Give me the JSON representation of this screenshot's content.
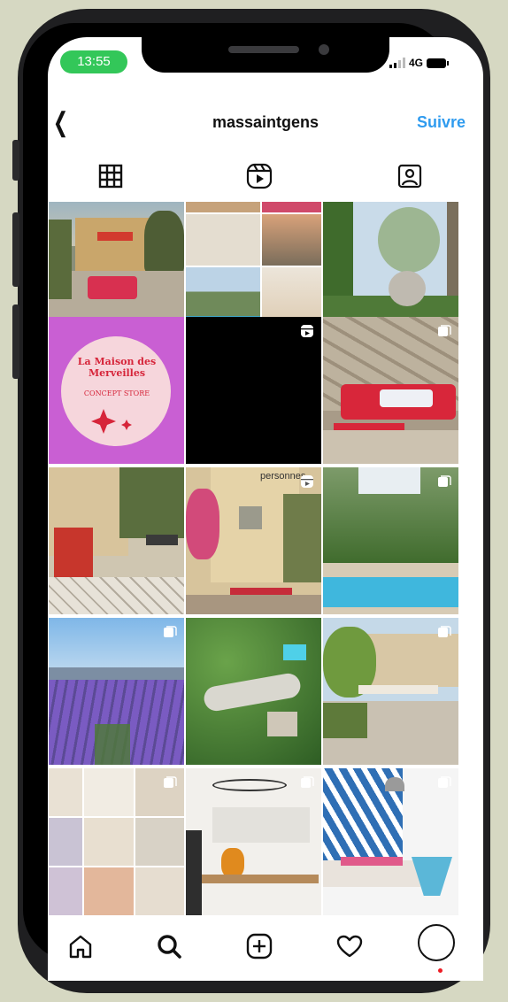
{
  "status_bar": {
    "time": "13:55",
    "network": "4G"
  },
  "header": {
    "back_icon": "chevron-left-icon",
    "username": "massaintgens",
    "follow_label": "Suivre"
  },
  "tabs": [
    {
      "name": "tab-posts",
      "icon": "grid-icon",
      "active": true
    },
    {
      "name": "tab-reels",
      "icon": "reels-icon",
      "active": false
    },
    {
      "name": "tab-tagged",
      "icon": "tagged-person-icon",
      "active": false
    }
  ],
  "posts": [
    {
      "name": "post-1",
      "subject": "terrace-facade",
      "badge": null
    },
    {
      "name": "post-2",
      "subject": "photo-collage",
      "badge": null
    },
    {
      "name": "post-3",
      "subject": "garden-tree",
      "badge": null
    },
    {
      "name": "post-4",
      "subject": "logo",
      "badge": null,
      "logo_text": "La Maison des Merveilles",
      "logo_sub": "CONCEPT STORE"
    },
    {
      "name": "post-5",
      "subject": "black-video",
      "badge": "reels-icon"
    },
    {
      "name": "post-6",
      "subject": "stone-wall-bench",
      "badge": "carousel-icon"
    },
    {
      "name": "post-7",
      "subject": "courtyard",
      "badge": null
    },
    {
      "name": "post-8",
      "subject": "house-flowers",
      "badge": "reels-icon",
      "overlay_text": "personnes"
    },
    {
      "name": "post-9",
      "subject": "pool",
      "badge": "carousel-icon"
    },
    {
      "name": "post-10",
      "subject": "lavender",
      "badge": "carousel-icon"
    },
    {
      "name": "post-11",
      "subject": "aerial",
      "badge": null
    },
    {
      "name": "post-12",
      "subject": "patio-house",
      "badge": "carousel-icon"
    },
    {
      "name": "post-13",
      "subject": "rooms-collage",
      "badge": "carousel-icon"
    },
    {
      "name": "post-14",
      "subject": "kitchen",
      "badge": "carousel-icon"
    },
    {
      "name": "post-15",
      "subject": "living-room",
      "badge": "carousel-icon"
    }
  ],
  "bottom_nav": [
    {
      "name": "nav-home",
      "icon": "home-icon"
    },
    {
      "name": "nav-search",
      "icon": "search-icon"
    },
    {
      "name": "nav-create",
      "icon": "add-post-icon"
    },
    {
      "name": "nav-activity",
      "icon": "heart-icon"
    },
    {
      "name": "nav-profile",
      "icon": "profile-avatar-icon"
    }
  ],
  "colors": {
    "follow": "#2f9bef",
    "time_pill": "#33c759",
    "logo_bg": "#c95fd3",
    "logo_text": "#d6253a",
    "notification_dot": "#ed1c24"
  }
}
